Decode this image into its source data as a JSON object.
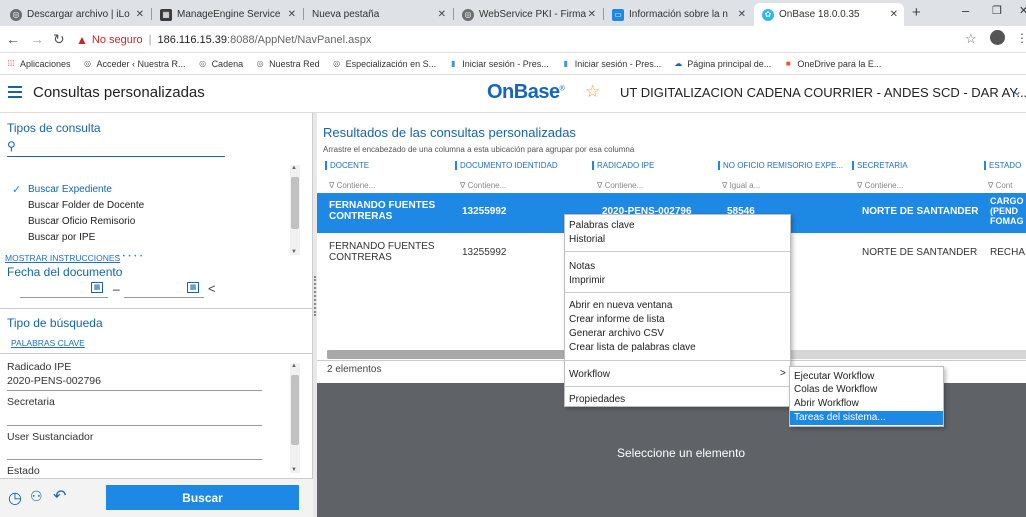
{
  "browser": {
    "tabs": [
      {
        "label": "Descargar archivo | iLo",
        "icon": "globe-icon"
      },
      {
        "label": "ManageEngine Service",
        "icon": "manageengine-icon"
      },
      {
        "label": "Nueva pestaña",
        "icon": ""
      },
      {
        "label": "WebService PKI - Firma",
        "icon": "globe-icon"
      },
      {
        "label": "Información sobre la n",
        "icon": "doc-icon"
      },
      {
        "label": "OnBase 18.0.0.35",
        "icon": "onbase-icon"
      }
    ],
    "new_tab": "+",
    "security_label": "No seguro",
    "url_host": "186.116.15.39",
    "url_rest": ":8088/AppNet/NavPanel.aspx",
    "bookmarks": [
      "Aplicaciones",
      "Acceder ‹ Nuestra R...",
      "Cadena",
      "Nuestra Red",
      "Especialización en S...",
      "Iniciar sesión - Pres...",
      "Iniciar sesión - Pres...",
      "Página principal de...",
      "OneDrive para la E..."
    ],
    "bookmarks_more": "»"
  },
  "header": {
    "title": "Consultas personalizadas",
    "logo": "OnBase",
    "tm": "®",
    "workspace": "UT DIGITALIZACION CADENA COURRIER - ANDES SCD - DAR AY..."
  },
  "left": {
    "tipos_title": "Tipos de consulta",
    "query_types": [
      "Buscar Expediente",
      "Buscar Folder de Docente",
      "Buscar Oficio Remisorio",
      "Buscar por IPE"
    ],
    "mostrar": "MOSTRAR INSTRUCCIONES",
    "dots": "• • • • •",
    "fecha_title": "Fecha del documento",
    "date_sep": "–",
    "date_nav": "<",
    "tipo_busqueda_title": "Tipo de búsqueda",
    "palabras": "PALABRAS CLAVE",
    "fields": [
      {
        "label": "Radicado IPE",
        "value": "2020-PENS-002796"
      },
      {
        "label": "Secretaria",
        "value": ""
      },
      {
        "label": "User Sustanciador",
        "value": ""
      },
      {
        "label": "Estado",
        "value": ""
      }
    ],
    "search_button": "Buscar"
  },
  "results": {
    "title": "Resultados de las consultas personalizadas",
    "instruction": "Arrastre el encabezado de una columna a esta ubicación para agrupar por esa columna",
    "columns": [
      "DOCENTE",
      "DOCUMENTO IDENTIDAD",
      "RADICADO IPE",
      "NO OFICIO REMISORIO EXPE...",
      "SECRETARIA",
      "ESTADO"
    ],
    "filters": [
      "∇ Contiene...",
      "∇ Contiene...",
      "∇ Contiene...",
      "∇ Igual a...",
      "∇ Contiene...",
      "∇ Cont"
    ],
    "rows": [
      {
        "docente": "FERNANDO FUENTES CONTRERAS",
        "doc_id": "13255992",
        "radicado": "2020-PENS-002796",
        "oficio": "58546",
        "secretaria": "NORTE DE SANTANDER",
        "estado": "CARGO (PEND FOMAG"
      },
      {
        "docente": "FERNANDO FUENTES CONTRERAS",
        "doc_id": "13255992",
        "radicado": "",
        "oficio": "",
        "secretaria": "NORTE DE SANTANDER",
        "estado": "RECHA"
      }
    ],
    "count": "2 elementos",
    "select_prompt": "Seleccione un elemento"
  },
  "context_menu": {
    "items": [
      "Palabras clave",
      "Historial",
      "Notas",
      "Imprimir",
      "Abrir en nueva ventana",
      "Crear informe de lista",
      "Generar archivo CSV",
      "Crear lista de palabras clave",
      "Workflow",
      "Propiedades"
    ],
    "submenu_arrow": ">"
  },
  "submenu": {
    "items": [
      "Ejecutar Workflow",
      "Colas de Workflow",
      "Abrir Workflow",
      "Tareas del sistema..."
    ]
  },
  "colors": {
    "accent": "#1e88e5",
    "selected_row": "#1e88e5",
    "title_blue": "#1565a8",
    "logo_blue": "#1565c0",
    "tab_bg": "#dee1e6"
  }
}
